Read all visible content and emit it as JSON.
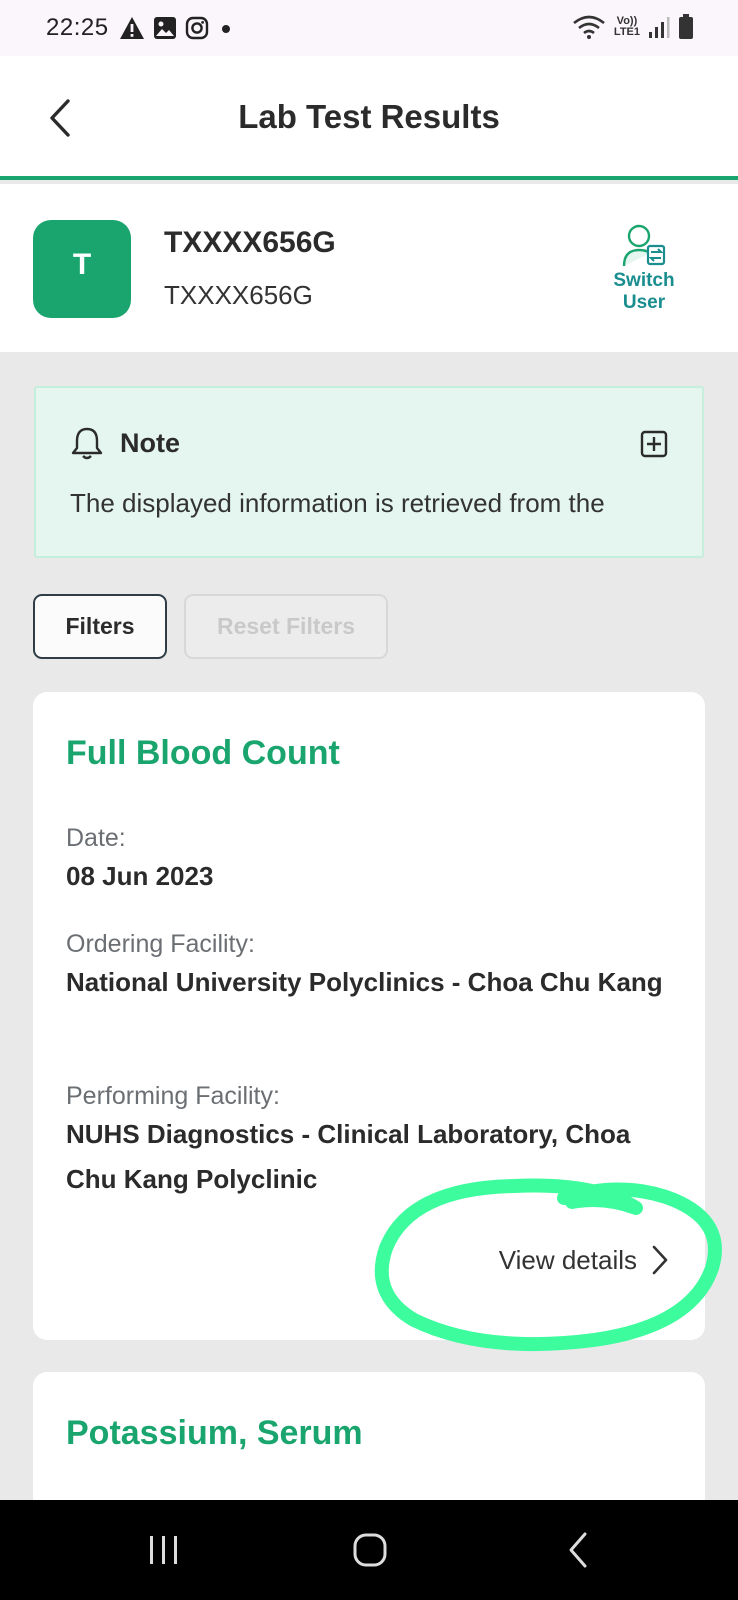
{
  "status_bar": {
    "time": "22:25",
    "left_icons": [
      "warning-icon",
      "image-icon",
      "instagram-icon",
      "dot-icon"
    ],
    "network_label_top": "Vo))",
    "network_label_bottom": "LTE1",
    "right_icons": [
      "wifi-icon",
      "signal-icon",
      "battery-icon"
    ]
  },
  "header": {
    "title": "Lab Test Results",
    "back_icon": "chevron-left-icon"
  },
  "profile": {
    "avatar_letter": "T",
    "name": "TXXXX656G",
    "id": "TXXXX656G",
    "switch_user_line1": "Switch",
    "switch_user_line2": "User"
  },
  "note": {
    "title": "Note",
    "text": "The displayed information is retrieved from the"
  },
  "filters": {
    "filters_label": "Filters",
    "reset_label": "Reset Filters"
  },
  "results": [
    {
      "title": "Full Blood Count",
      "date_label": "Date:",
      "date_value": "08 Jun 2023",
      "ordering_label": "Ordering Facility:",
      "ordering_value": "National University Polyclinics - Choa Chu Kang",
      "performing_label": "Performing Facility:",
      "performing_value": "NUHS Diagnostics - Clinical Laboratory, Choa Chu Kang Polyclinic",
      "view_details_label": "View details"
    },
    {
      "title": "Potassium, Serum"
    }
  ],
  "colors": {
    "brand_green": "#1aa56e",
    "note_background": "#e4f6ef",
    "switch_user_teal": "#1a8d8f",
    "highlight_annotation": "#3dfc9d"
  }
}
